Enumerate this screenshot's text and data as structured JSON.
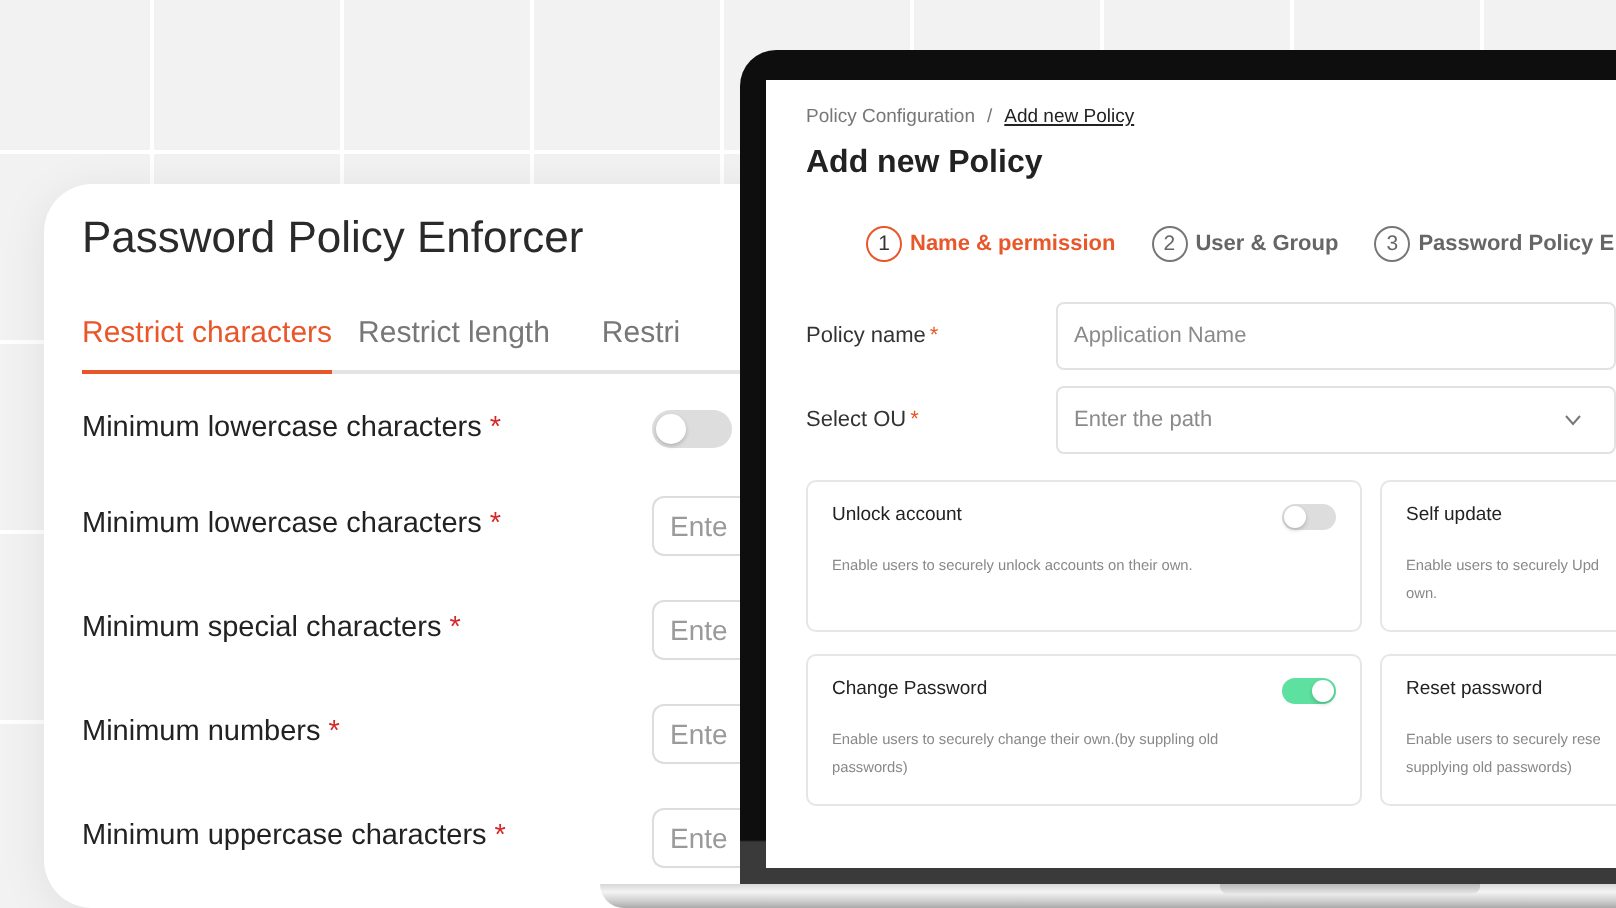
{
  "left_panel": {
    "title": "Password Policy Enforcer",
    "tabs": [
      {
        "label": "Restrict characters",
        "selected": true
      },
      {
        "label": "Restrict length",
        "selected": false
      },
      {
        "label": "Restri",
        "selected": false
      }
    ],
    "rows": [
      {
        "label": "Minimum lowercase characters",
        "required_mark": "*",
        "kind": "toggle",
        "on": false
      },
      {
        "label": "Minimum lowercase characters",
        "required_mark": "*",
        "kind": "input",
        "placeholder": "Ente"
      },
      {
        "label": "Minimum special characters",
        "required_mark": "*",
        "kind": "input",
        "placeholder": "Ente"
      },
      {
        "label": "Minimum numbers",
        "required_mark": "*",
        "kind": "input",
        "placeholder": "Ente"
      },
      {
        "label": "Minimum uppercase characters",
        "required_mark": "*",
        "kind": "input",
        "placeholder": "Ente"
      }
    ]
  },
  "policy_screen": {
    "breadcrumb": [
      {
        "label": "Policy Configuration",
        "current": false
      },
      {
        "label": "Add new Policy",
        "current": true
      }
    ],
    "breadcrumb_separator": "/",
    "title": "Add new Policy",
    "steps": [
      {
        "number": "1",
        "label": "Name & permission",
        "selected": true
      },
      {
        "number": "2",
        "label": "User & Group",
        "selected": false
      },
      {
        "number": "3",
        "label": "Password Policy E",
        "selected": false
      }
    ],
    "fields": [
      {
        "label": "Policy name",
        "required_mark": "*",
        "kind": "text",
        "placeholder": "Application Name"
      },
      {
        "label": "Select OU",
        "required_mark": "*",
        "kind": "select",
        "placeholder": "Enter the path"
      }
    ],
    "features": [
      {
        "title": "Unlock account",
        "description": "Enable users to securely unlock accounts on their  own.",
        "kind": "toggle",
        "on": false
      },
      {
        "title": "Self update",
        "description": "Enable users to securely Upd\nown.",
        "kind": "plain"
      },
      {
        "title": "Change Password",
        "description": "Enable users to securely change their own.(by suppling old\npasswords)",
        "kind": "toggle",
        "on": true
      },
      {
        "title": "Reset password",
        "description": "Enable users to securely rese\nsupplying old passwords)",
        "kind": "plain"
      }
    ]
  }
}
